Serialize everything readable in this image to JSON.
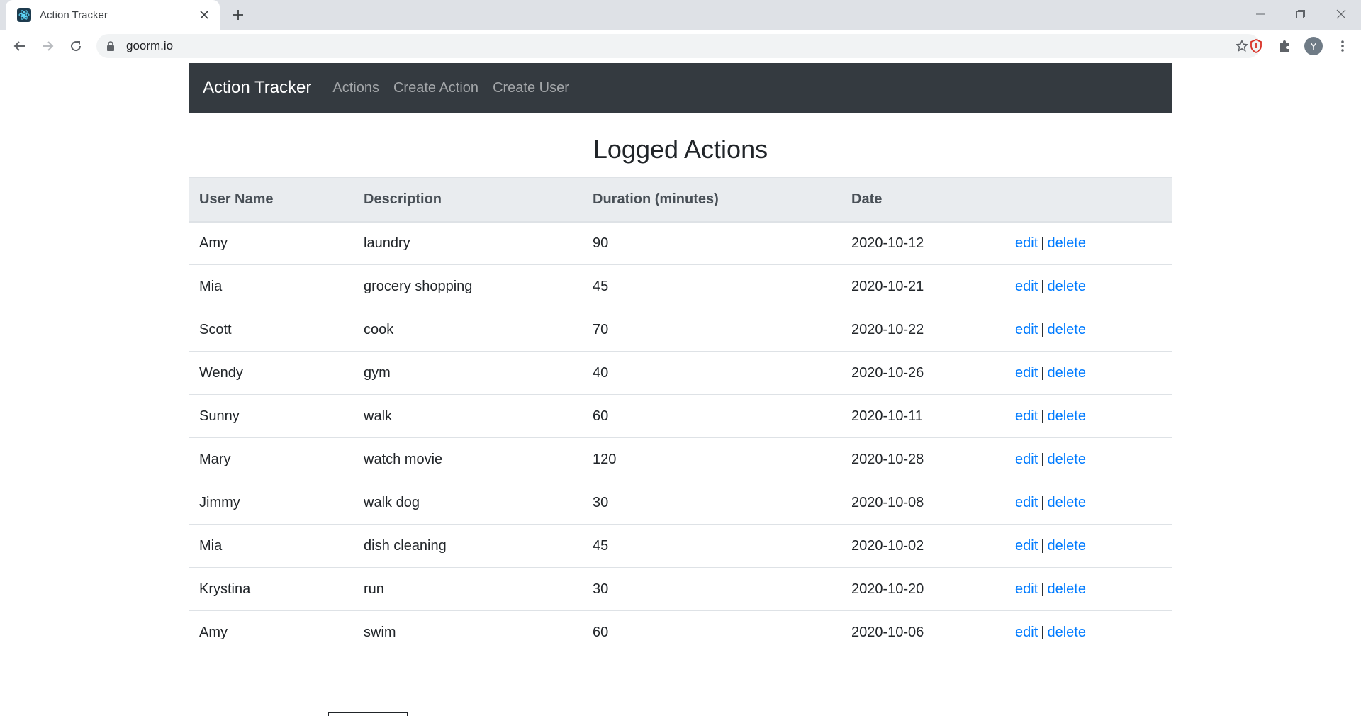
{
  "browser": {
    "tab_title": "Action Tracker",
    "url": "goorm.io",
    "profile_initial": "Y"
  },
  "navbar": {
    "brand": "Action Tracker",
    "links": [
      "Actions",
      "Create Action",
      "Create User"
    ]
  },
  "page": {
    "title": "Logged Actions"
  },
  "table": {
    "headers": [
      "User Name",
      "Description",
      "Duration (minutes)",
      "Date"
    ],
    "edit_label": "edit",
    "delete_label": "delete",
    "separator": "|",
    "rows": [
      {
        "user": "Amy",
        "description": "laundry",
        "duration": "90",
        "date": "2020-10-12"
      },
      {
        "user": "Mia",
        "description": "grocery shopping",
        "duration": "45",
        "date": "2020-10-21"
      },
      {
        "user": "Scott",
        "description": "cook",
        "duration": "70",
        "date": "2020-10-22"
      },
      {
        "user": "Wendy",
        "description": "gym",
        "duration": "40",
        "date": "2020-10-26"
      },
      {
        "user": "Sunny",
        "description": "walk",
        "duration": "60",
        "date": "2020-10-11"
      },
      {
        "user": "Mary",
        "description": "watch movie",
        "duration": "120",
        "date": "2020-10-28"
      },
      {
        "user": "Jimmy",
        "description": "walk dog",
        "duration": "30",
        "date": "2020-10-08"
      },
      {
        "user": "Mia",
        "description": "dish cleaning",
        "duration": "45",
        "date": "2020-10-02"
      },
      {
        "user": "Krystina",
        "description": "run",
        "duration": "30",
        "date": "2020-10-20"
      },
      {
        "user": "Amy",
        "description": "swim",
        "duration": "60",
        "date": "2020-10-06"
      }
    ]
  },
  "colors": {
    "navbar_bg": "#343a40",
    "link": "#007bff",
    "table_head_bg": "#e9ecef"
  }
}
